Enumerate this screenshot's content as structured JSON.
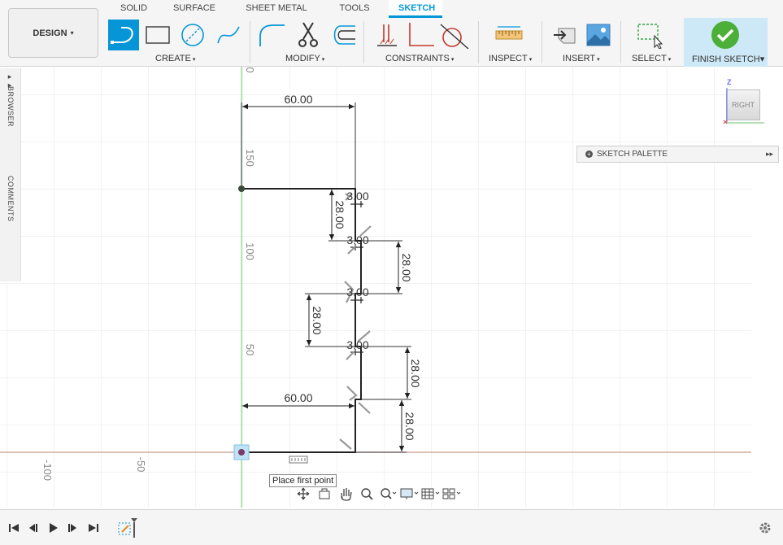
{
  "workspace_button": {
    "label": "DESIGN",
    "caret": "▾"
  },
  "tabs": [
    {
      "label": "SOLID",
      "active": false
    },
    {
      "label": "SURFACE",
      "active": false
    },
    {
      "label": "SHEET METAL",
      "active": false
    },
    {
      "label": "TOOLS",
      "active": false
    },
    {
      "label": "SKETCH",
      "active": true
    }
  ],
  "groups": {
    "create": "CREATE",
    "modify": "MODIFY",
    "constraints": "CONSTRAINTS",
    "inspect": "INSPECT",
    "insert": "INSERT",
    "select": "SELECT",
    "finish": "FINISH SKETCH"
  },
  "caret": "▾",
  "browser": {
    "browser_label": "BROWSER",
    "comments_label": "COMMENTS",
    "expand": "▸▸"
  },
  "sketch_palette": {
    "label": "SKETCH PALETTE",
    "expand": "▸▸"
  },
  "viewcube": {
    "face": "RIGHT",
    "axis_z": "Z"
  },
  "axis_labels": {
    "y": [
      "150",
      "100",
      "50",
      "0"
    ],
    "x": [
      "-100",
      "-50"
    ]
  },
  "dimensions": {
    "top_width": "60.00",
    "bottom_width": "60.00",
    "step_offsets": [
      "3.00",
      "3.00",
      "3.00",
      "3.00"
    ],
    "step_heights": [
      "28.00",
      "28.00",
      "28.00",
      "28.00",
      "28.00"
    ]
  },
  "tooltip": "Place first point",
  "colors": {
    "accent": "#0696d7",
    "finish_bg": "#cde8f6",
    "check_green": "#4caf38",
    "y_axis": "#7ed87e",
    "x_axis": "#c9927a",
    "grid": "#e8e8e8"
  }
}
